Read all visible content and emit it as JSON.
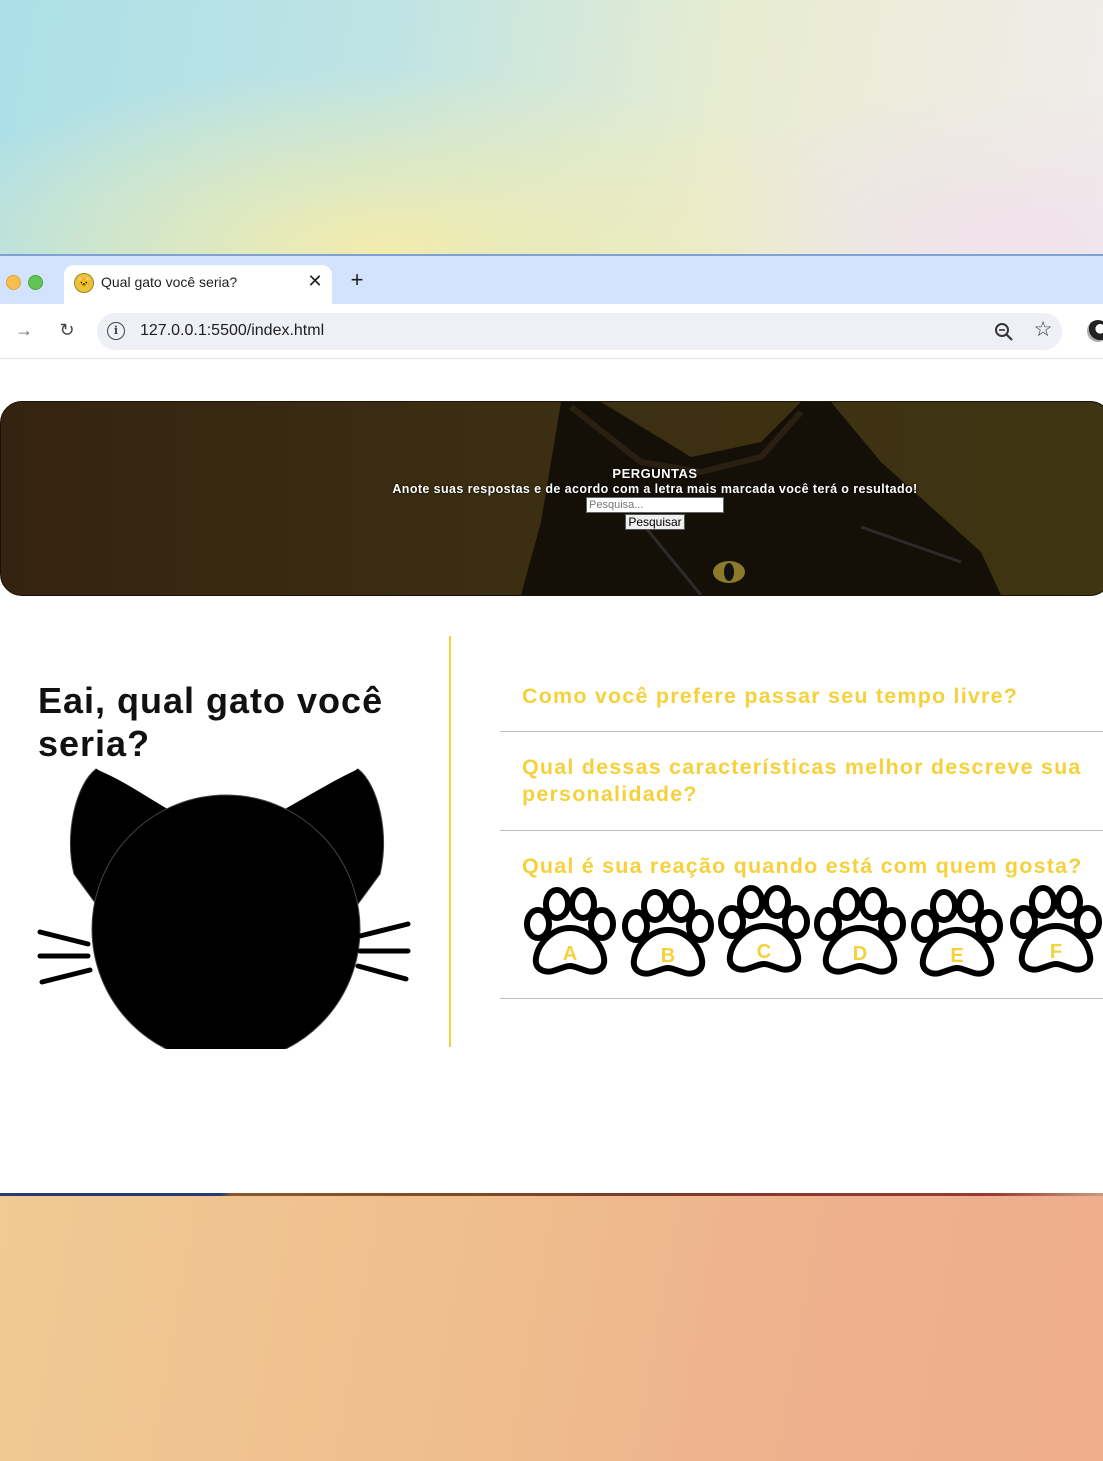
{
  "browser": {
    "tab_title": "Qual gato você seria?",
    "tab_close": "✕",
    "new_tab": "+",
    "url": "127.0.0.1:5500/index.html",
    "forward": "→",
    "reload": "↻",
    "star": "☆"
  },
  "hero": {
    "title": "PERGUNTAS",
    "subtitle": "Anote suas respostas e de acordo com a letra mais marcada você terá o resultado!",
    "search_placeholder": "Pesquisa...",
    "search_button": "Pesquisar"
  },
  "main": {
    "heading": "Eai, qual gato você seria?",
    "questions": [
      "Como você prefere passar seu tempo livre?",
      "Qual dessas características melhor descreve sua personalidade?",
      "Qual é sua reação quando está com quem gosta?"
    ],
    "options": [
      "A",
      "B",
      "C",
      "D",
      "E",
      "F"
    ]
  },
  "colors": {
    "question_text": "#f5d13c",
    "divider": "#f0cf42",
    "hero_bg": "#3c2e12"
  }
}
